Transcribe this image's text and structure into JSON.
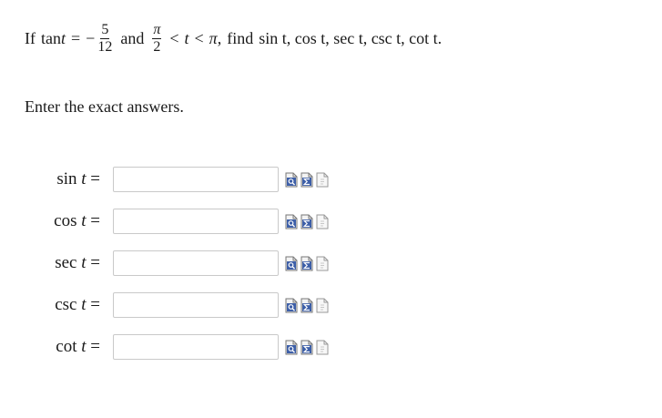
{
  "problem": {
    "if": "If",
    "tan": "tan",
    "t": "t",
    "eq": "=",
    "minus": "−",
    "num": "5",
    "den": "12",
    "and": "and",
    "pi": "π",
    "two": "2",
    "lt": "<",
    "comma": ",",
    "find": "find",
    "targets": "sin t, cos t, sec t, csc t, cot t."
  },
  "instruction": "Enter the exact answers.",
  "answers": [
    {
      "fn": "sin",
      "var": "t",
      "eq": "=",
      "value": ""
    },
    {
      "fn": "cos",
      "var": "t",
      "eq": "=",
      "value": ""
    },
    {
      "fn": "sec",
      "var": "t",
      "eq": "=",
      "value": ""
    },
    {
      "fn": "csc",
      "var": "t",
      "eq": "=",
      "value": ""
    },
    {
      "fn": "cot",
      "var": "t",
      "eq": "=",
      "value": ""
    }
  ],
  "tool_icons": [
    "preview-icon",
    "equation-editor-icon",
    "help-page-icon"
  ],
  "colors": {
    "icon_blue": "#3d5fa8",
    "icon_paper": "#f3f3f3",
    "input_border": "#c9c9c9"
  }
}
